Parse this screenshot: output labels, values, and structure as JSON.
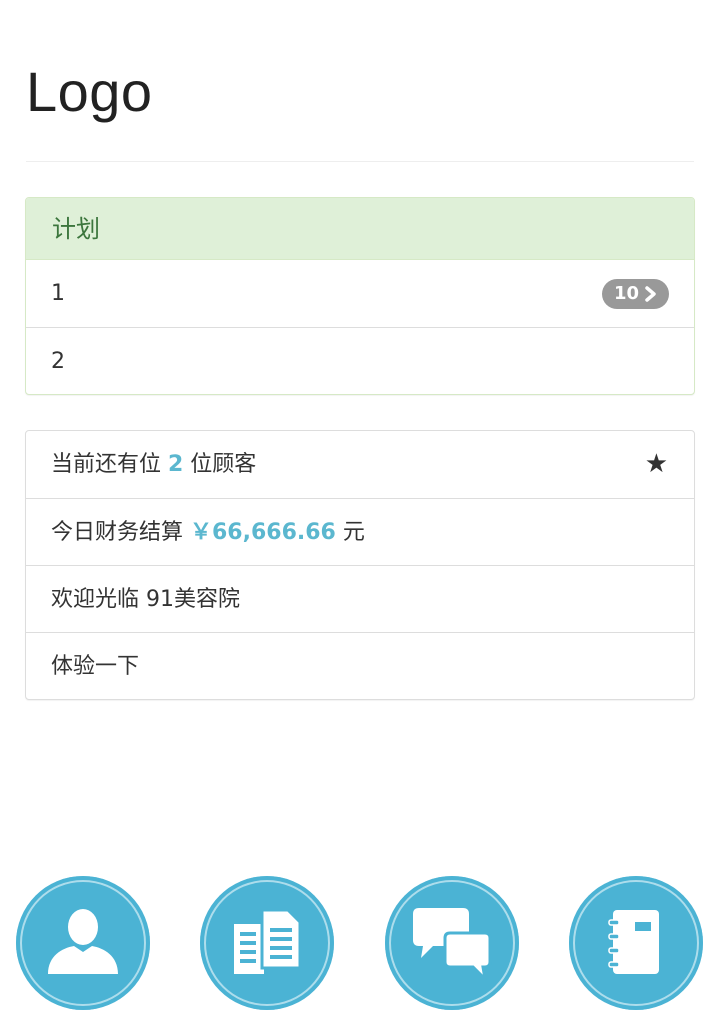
{
  "header": {
    "logo": "Logo"
  },
  "plan_panel": {
    "title": "计划",
    "items": [
      {
        "label": "1",
        "badge": "10"
      },
      {
        "label": "2"
      }
    ]
  },
  "info_panel": {
    "customers": {
      "prefix": "当前还有位 ",
      "count": "2",
      "suffix": " 位顾客"
    },
    "finance": {
      "prefix": "今日财务结算 ",
      "amount": "￥66,666.66",
      "suffix": " 元"
    },
    "welcome": "欢迎光临 91美容院",
    "try_it": "体验一下"
  },
  "footer": {
    "icons": [
      "user-icon",
      "documents-icon",
      "chat-icon",
      "notebook-icon"
    ]
  },
  "colors": {
    "accent": "#5bb7cf",
    "icon_circle": "#4bb3d4",
    "success_heading_bg": "#dff0d8",
    "success_heading_text": "#3c763d",
    "badge_bg": "#999999"
  }
}
